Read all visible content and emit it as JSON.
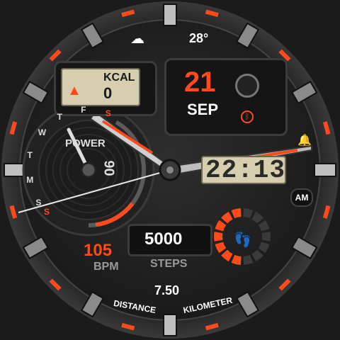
{
  "weather": {
    "icon": "cloud-storm-icon",
    "temperature": "28°"
  },
  "calories": {
    "label": "KCAL",
    "value": "0",
    "icon": "flame-icon"
  },
  "date": {
    "day": "21",
    "month": "SEP",
    "moon_icon": "moon-phase-icon",
    "bt_icon": "bluetooth-icon"
  },
  "power": {
    "label": "POWER",
    "value": "90",
    "level_percent": 90
  },
  "weekdays": [
    "S",
    "F",
    "T",
    "W",
    "T",
    "M",
    "S"
  ],
  "weekday_active_index": 0,
  "time": {
    "digital": "22:13",
    "ampm": "AM",
    "alarm_icon": "bell-icon"
  },
  "heart": {
    "value": "105",
    "unit": "BPM"
  },
  "steps": {
    "value": "5000",
    "label": "STEPS",
    "icon": "footprints-icon",
    "progress_fraction": 0.5
  },
  "distance": {
    "value": "7.50",
    "label_left": "DISTANCE",
    "label_right": "KILOMETER"
  },
  "colors": {
    "accent": "#ff4a1c",
    "lcd": "#d7ceb0",
    "dark": "#151515",
    "text": "#ffffff"
  }
}
